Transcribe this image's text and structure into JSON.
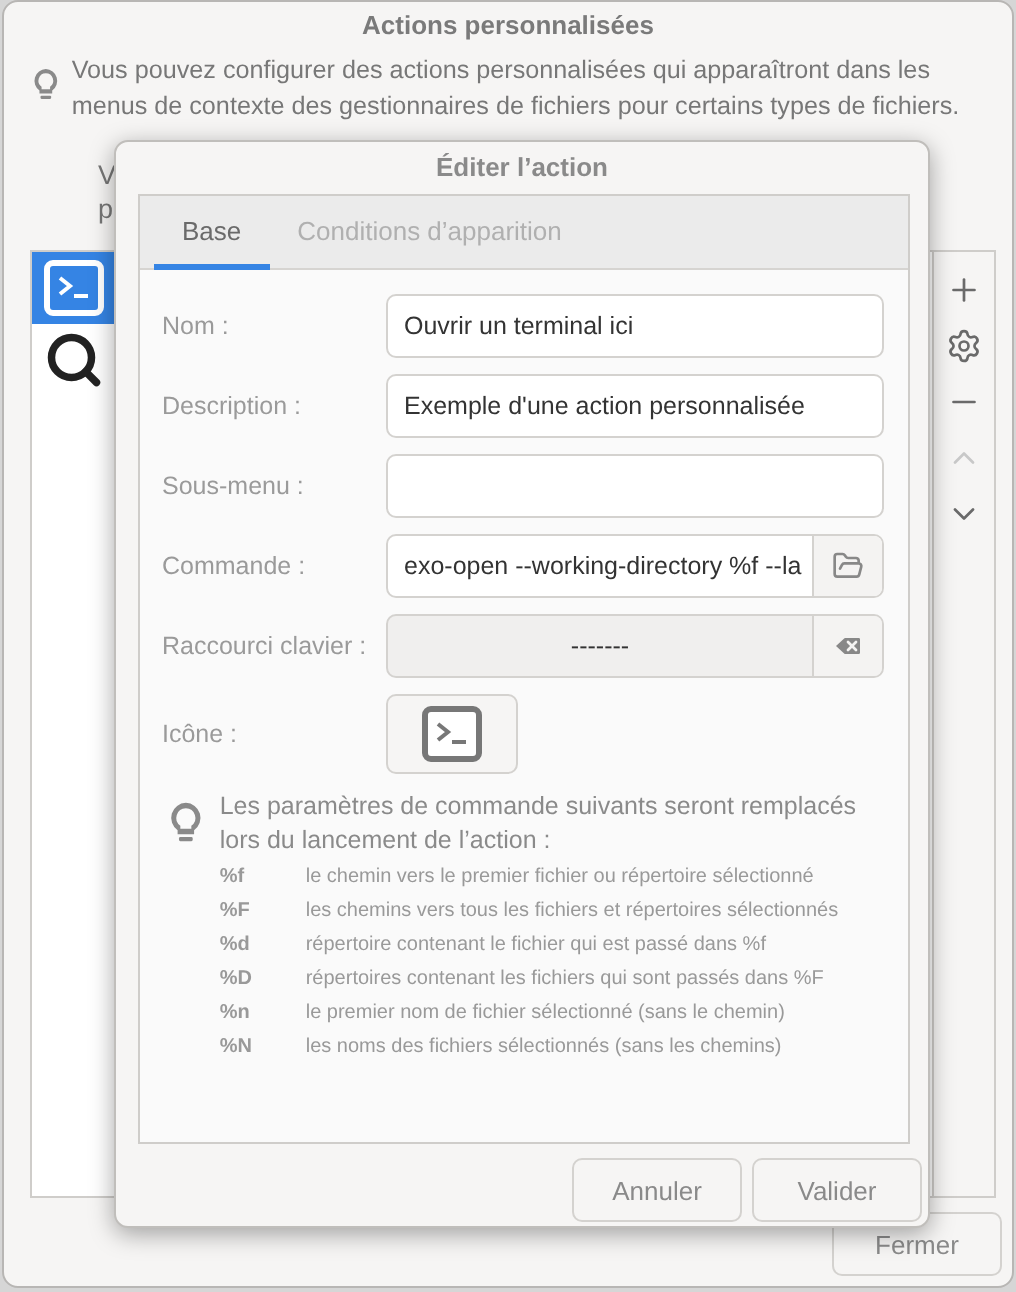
{
  "window": {
    "title": "Actions personnalisées"
  },
  "intro": "Vous pouvez configurer des actions personnalisées qui apparaîtront dans les menus de contexte des gestionnaires de fichiers pour certains types de fichiers.",
  "partial_lines": [
    "V",
    "p"
  ],
  "actions": [
    {
      "kind": "terminal",
      "selected": true
    },
    {
      "kind": "search",
      "selected": false
    }
  ],
  "toolbar": [
    {
      "kind": "add",
      "disabled": false
    },
    {
      "kind": "settings",
      "disabled": false
    },
    {
      "kind": "remove",
      "disabled": false
    },
    {
      "kind": "up",
      "disabled": true
    },
    {
      "kind": "down",
      "disabled": false
    }
  ],
  "close_button": "Fermer",
  "dialog": {
    "title": "Éditer l’action",
    "tabs": [
      {
        "label": "Base",
        "selected": true
      },
      {
        "label": "Conditions d’apparition",
        "selected": false
      }
    ],
    "fields": [
      {
        "kind": "text",
        "label": "Nom :",
        "value": "Ouvrir un terminal ici"
      },
      {
        "kind": "text",
        "label": "Description :",
        "value": "Exemple d'une action personnalisée"
      },
      {
        "kind": "text",
        "label": "Sous-menu :"
      },
      {
        "kind": "browse",
        "label": "Commande :",
        "value": "exo-open --working-directory %f --la"
      },
      {
        "kind": "shortcut",
        "label": "Raccourci clavier :",
        "value": "-------"
      },
      {
        "kind": "icon",
        "label": "Icône :"
      }
    ],
    "hint": "Les paramètres de commande suivants seront remplacés lors du lancement de l’action :",
    "parameters": [
      {
        "code": "%f",
        "text": "le chemin vers le premier fichier ou répertoire sélectionné"
      },
      {
        "code": "%F",
        "text": "les chemins vers tous les fichiers et répertoires sélectionnés"
      },
      {
        "code": "%d",
        "text": "répertoire contenant le fichier qui est passé dans %f"
      },
      {
        "code": "%D",
        "text": "répertoires contenant les fichiers qui sont passés dans %F"
      },
      {
        "code": "%n",
        "text": "le premier nom de fichier sélectionné (sans le chemin)"
      },
      {
        "code": "%N",
        "text": "les noms des fichiers sélectionnés (sans les chemins)"
      }
    ],
    "buttons": [
      "Annuler",
      "Valider"
    ]
  }
}
